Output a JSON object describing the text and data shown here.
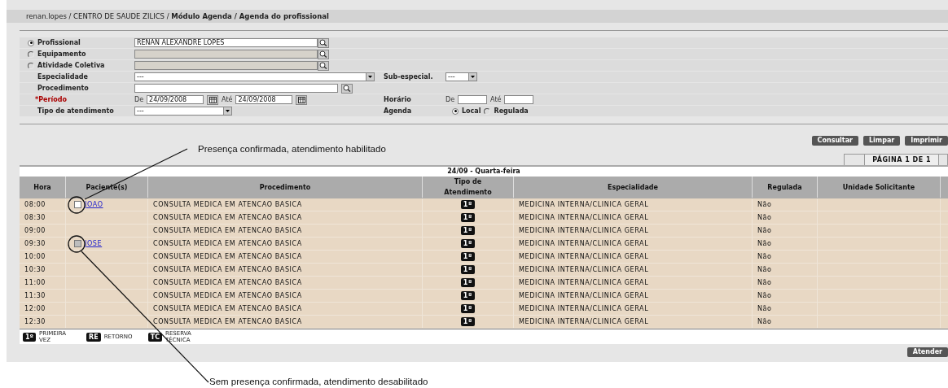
{
  "breadcrumb": "renan.lopes / CENTRO DE SAUDE ZILICS /  **Módulo Agenda / Agenda do profissional**",
  "form": {
    "search_by": [
      {
        "label": "Profissional",
        "selected": true,
        "value": "RENAN ALEXANDRE LOPES",
        "disabled": false
      },
      {
        "label": "Equipamento",
        "selected": false,
        "disabled": true
      },
      {
        "label": "Atividade Coletiva",
        "selected": false,
        "disabled": true
      }
    ],
    "especialidade": {
      "label": "Especialidade",
      "value": "---"
    },
    "sub_especialidade": {
      "label": "Sub-especial.",
      "value": "---"
    },
    "procedimento": {
      "label": "Procedimento"
    },
    "periodo": {
      "label": "*Período",
      "from_label": "De",
      "from": "24/09/2008",
      "to_label": "Até",
      "to": "24/09/2008"
    },
    "horario": {
      "label": "Horário",
      "from_label": "De",
      "to_label": "Até"
    },
    "tipo_atendimento": {
      "label": "Tipo de atendimento",
      "value": "---"
    },
    "agenda": {
      "label": "Agenda",
      "options": [
        {
          "label": "Local",
          "selected": true
        },
        {
          "label": "Regulada",
          "selected": false
        }
      ]
    }
  },
  "buttons": [
    "Consultar",
    "Limpar",
    "Imprimir"
  ],
  "pagination": "PÁGINA 1 DE 1",
  "table": {
    "date": "24/09 - Quarta-feira",
    "columns": [
      "Hora",
      "Paciente(s)",
      "Procedimento",
      "Tipo de Atendimento",
      "Especialidade",
      "Regulada",
      "Unidade Solicitante"
    ],
    "rows": [
      {
        "hora": "08:00",
        "paciente": "JOAO",
        "checkbox_disabled": false,
        "procedimento": "CONSULTA MEDICA EM ATENCAO BASICA",
        "tipo": "1º",
        "especialidade": "MEDICINA INTERNA/CLINICA GERAL",
        "regulada": "Não"
      },
      {
        "hora": "08:30",
        "procedimento": "CONSULTA MEDICA EM ATENCAO BASICA",
        "tipo": "1º",
        "especialidade": "MEDICINA INTERNA/CLINICA GERAL",
        "regulada": "Não"
      },
      {
        "hora": "09:00",
        "procedimento": "CONSULTA MEDICA EM ATENCAO BASICA",
        "tipo": "1º",
        "especialidade": "MEDICINA INTERNA/CLINICA GERAL",
        "regulada": "Não"
      },
      {
        "hora": "09:30",
        "paciente": "JOSE",
        "checkbox_disabled": true,
        "procedimento": "CONSULTA MEDICA EM ATENCAO BASICA",
        "tipo": "1º",
        "especialidade": "MEDICINA INTERNA/CLINICA GERAL",
        "regulada": "Não"
      },
      {
        "hora": "10:00",
        "procedimento": "CONSULTA MEDICA EM ATENCAO BASICA",
        "tipo": "1º",
        "especialidade": "MEDICINA INTERNA/CLINICA GERAL",
        "regulada": "Não"
      },
      {
        "hora": "10:30",
        "procedimento": "CONSULTA MEDICA EM ATENCAO BASICA",
        "tipo": "1º",
        "especialidade": "MEDICINA INTERNA/CLINICA GERAL",
        "regulada": "Não"
      },
      {
        "hora": "11:00",
        "procedimento": "CONSULTA MEDICA EM ATENCAO BASICA",
        "tipo": "1º",
        "especialidade": "MEDICINA INTERNA/CLINICA GERAL",
        "regulada": "Não"
      },
      {
        "hora": "11:30",
        "procedimento": "CONSULTA MEDICA EM ATENCAO BASICA",
        "tipo": "1º",
        "especialidade": "MEDICINA INTERNA/CLINICA GERAL",
        "regulada": "Não"
      },
      {
        "hora": "12:00",
        "procedimento": "CONSULTA MEDICA EM ATENCAO BASICA",
        "tipo": "1º",
        "especialidade": "MEDICINA INTERNA/CLINICA GERAL",
        "regulada": "Não"
      },
      {
        "hora": "12:30",
        "procedimento": "CONSULTA MEDICA EM ATENCAO BASICA",
        "tipo": "1º",
        "especialidade": "MEDICINA INTERNA/CLINICA GERAL",
        "regulada": "Não"
      }
    ]
  },
  "legend": [
    {
      "code": "1º",
      "label": "PRIMEIRA VEZ"
    },
    {
      "code": "RE",
      "label": "RETORNO"
    },
    {
      "code": "TC",
      "label": "RESERVA TÉCNICA"
    }
  ],
  "action_button": "Atender",
  "annotations": [
    "Presença confirmada, atendimento habilitado",
    "Sem presença confirmada, atendimento desabilitado"
  ]
}
